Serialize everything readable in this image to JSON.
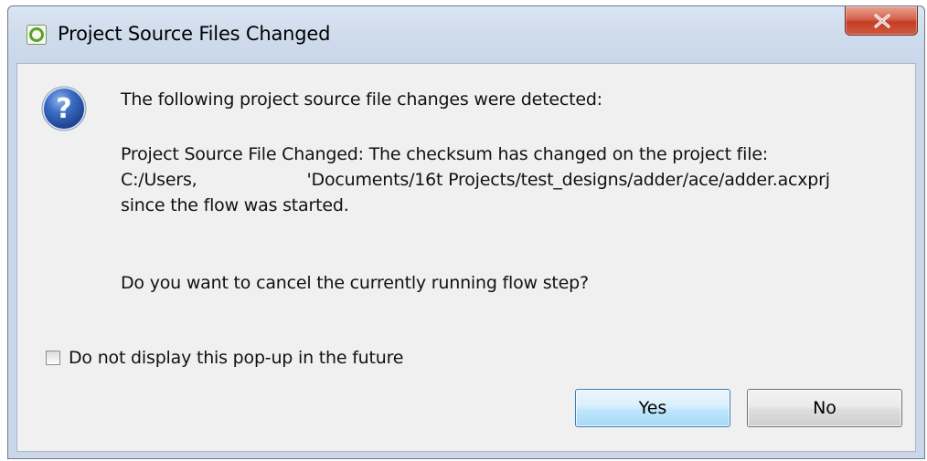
{
  "window": {
    "title": "Project Source Files Changed",
    "close_label": "X"
  },
  "message": {
    "intro": "The following project source file changes were detected:",
    "changed_line": "Project Source File Changed:  The checksum has changed on the project file:",
    "path_prefix": "C:/Users,",
    "path_suffix": "'Documents/16t Projects/test_designs/adder/ace/adder.acxprj",
    "since_line": "since the flow was started.",
    "question": "Do you want to cancel the currently running flow step?"
  },
  "checkbox": {
    "label": "Do not display this pop-up in the future",
    "checked": false
  },
  "buttons": {
    "yes": "Yes",
    "no": "No"
  },
  "icons": {
    "app": "app-ring-icon",
    "dialog": "question-icon",
    "close": "close-icon"
  },
  "colors": {
    "close_button": "#c43c24",
    "yes_button_border": "#3c7fb1",
    "question_icon": "#2a57a8",
    "app_icon": "#5aa02c"
  }
}
